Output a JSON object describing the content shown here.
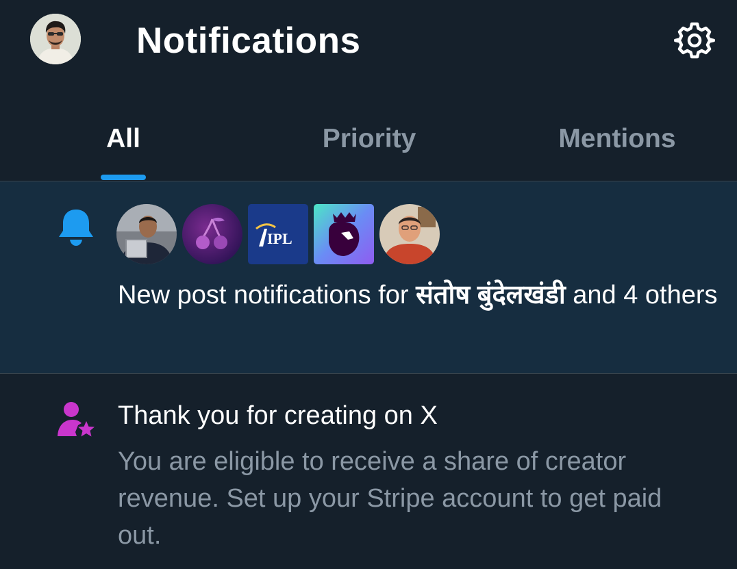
{
  "header": {
    "title": "Notifications",
    "avatar_icon": "user-avatar",
    "settings_icon": "gear-icon"
  },
  "tabs": [
    {
      "label": "All",
      "active": true
    },
    {
      "label": "Priority",
      "active": false
    },
    {
      "label": "Mentions",
      "active": false
    }
  ],
  "notifications": [
    {
      "type": "new-post",
      "icon": "bell-icon",
      "icon_color": "#1d9bf0",
      "avatars": [
        "person-avatar",
        "cherry-logo",
        "ipl-logo",
        "premier-league-logo",
        "person-avatar"
      ],
      "text_prefix": "New post notifications for ",
      "text_name": "संतोष बुंदेलखंडी",
      "text_suffix": " and 4 others"
    },
    {
      "type": "creator",
      "icon": "person-star-icon",
      "icon_color": "#c936cc",
      "title": "Thank you for creating on X",
      "body": "You are eligible to receive a share of creator revenue. Set up your Stripe account to get paid out."
    }
  ],
  "logos": {
    "ipl_text": "IPL"
  },
  "colors": {
    "background": "#15202b",
    "highlight_row": "#162d40",
    "accent": "#1d9bf0",
    "muted_text": "#8b98a5"
  }
}
